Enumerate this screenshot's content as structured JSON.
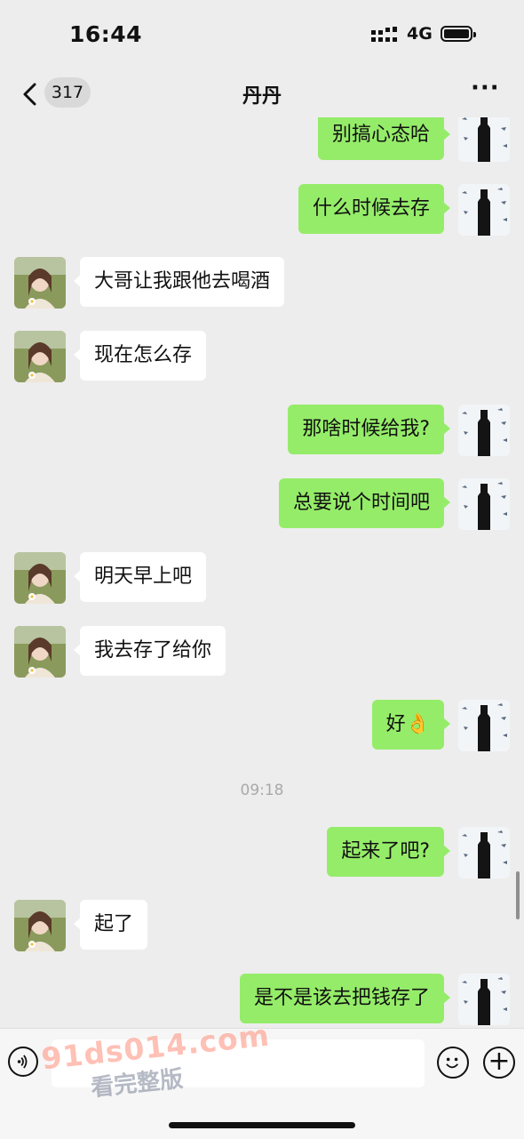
{
  "status_bar": {
    "time": "16:44",
    "network": "4G"
  },
  "nav": {
    "back_count": "317",
    "title": "丹丹",
    "more": "···"
  },
  "messages": [
    {
      "side": "me",
      "text": "别搞心态哈"
    },
    {
      "side": "me",
      "text": "什么时候去存"
    },
    {
      "side": "other",
      "text": "大哥让我跟他去喝酒"
    },
    {
      "side": "other",
      "text": "现在怎么存"
    },
    {
      "side": "me",
      "text": "那啥时候给我?"
    },
    {
      "side": "me",
      "text": "总要说个时间吧"
    },
    {
      "side": "other",
      "text": "明天早上吧"
    },
    {
      "side": "other",
      "text": "我去存了给你"
    },
    {
      "side": "me",
      "text": "好👌"
    },
    {
      "side": "me",
      "text": "起来了吧?"
    },
    {
      "side": "other",
      "text": "起了"
    },
    {
      "side": "me",
      "text": "是不是该去把钱存了"
    }
  ],
  "timestamp": "09:18",
  "watermark": {
    "line1": "91ds014.com",
    "line2": "看完整版"
  },
  "icons": {
    "voice": "voice-icon",
    "emoji": "emoji-icon",
    "plus": "plus-icon",
    "back": "chevron-left-icon",
    "more": "more-icon"
  },
  "colors": {
    "my_bubble": "#95ec69",
    "their_bubble": "#ffffff",
    "background": "#ededed"
  }
}
